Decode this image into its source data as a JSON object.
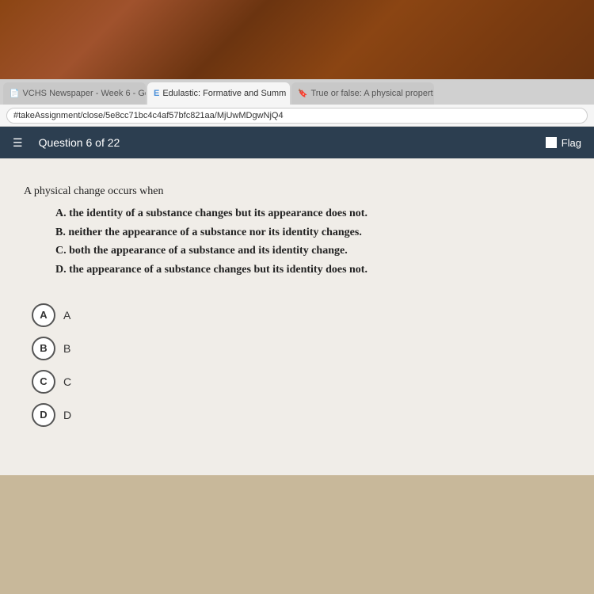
{
  "desk": {
    "visible": true
  },
  "browser": {
    "tabs": [
      {
        "id": "tab1",
        "label": "VCHS Newspaper - Week 6 - Goo",
        "icon": "📄",
        "active": false
      },
      {
        "id": "tab2",
        "label": "Edulastic: Formative and Summ",
        "icon": "E",
        "active": true
      },
      {
        "id": "tab3",
        "label": "True or false: A physical propert",
        "icon": "🔖",
        "active": false
      }
    ],
    "address": "#takeAssignment/close/5e8cc71bc4c4af57bfc821aa/MjUwMDgwNjQ4"
  },
  "toolbar": {
    "question_label": "Question 6 of 22",
    "flag_label": "Flag"
  },
  "question": {
    "stem": "A physical change occurs when",
    "choices": [
      {
        "letter": "A",
        "text": "the identity of a substance changes but its appearance does not."
      },
      {
        "letter": "B",
        "text": "neither the appearance of a substance nor its identity changes."
      },
      {
        "letter": "C",
        "text": "both the appearance of a substance and its identity change."
      },
      {
        "letter": "D",
        "text": "the appearance of a substance changes but its identity does not."
      }
    ]
  },
  "answer_options": [
    {
      "letter": "A",
      "label": "A"
    },
    {
      "letter": "B",
      "label": "B"
    },
    {
      "letter": "C",
      "label": "C"
    },
    {
      "letter": "D",
      "label": "D"
    }
  ]
}
